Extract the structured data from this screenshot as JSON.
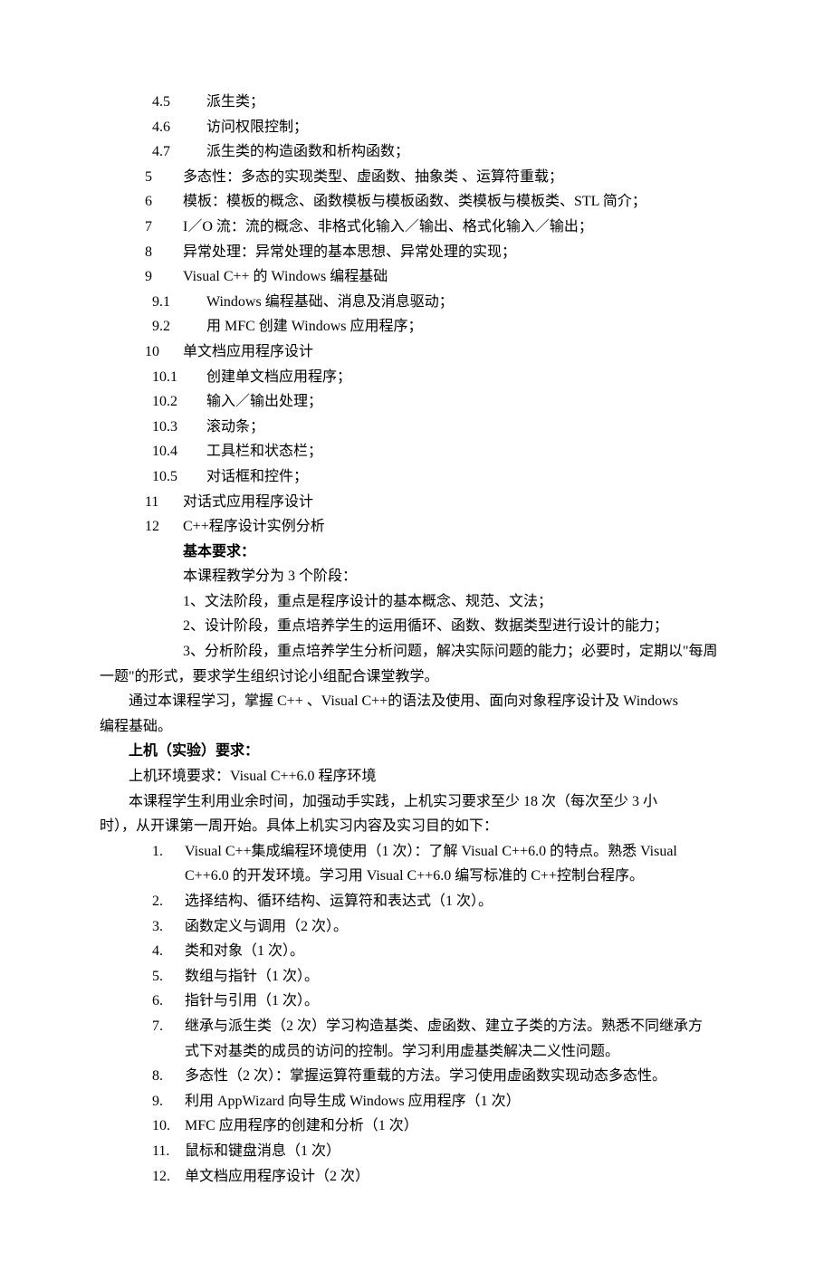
{
  "outline": {
    "sub4": [
      {
        "n": "4.5",
        "t": "派生类；"
      },
      {
        "n": "4.6",
        "t": "访问权限控制；"
      },
      {
        "n": "4.7",
        "t": "派生类的构造函数和析构函数；"
      }
    ],
    "top": [
      {
        "n": "5",
        "t": "多态性：多态的实现类型、虚函数、抽象类 、运算符重载；"
      },
      {
        "n": "6",
        "t": "模板：模板的概念、函数模板与模板函数、类模板与模板类、STL 简介；"
      },
      {
        "n": "7",
        "t": "I／O 流：流的概念、非格式化输入／输出、格式化输入／输出；"
      },
      {
        "n": "8",
        "t": "异常处理：异常处理的基本思想、异常处理的实现；"
      },
      {
        "n": "9",
        "t": "Visual C++  的 Windows 编程基础"
      }
    ],
    "sub9": [
      {
        "n": "9.1",
        "t": "Windows 编程基础、消息及消息驱动；"
      },
      {
        "n": "9.2",
        "t": "用 MFC 创建 Windows 应用程序；"
      }
    ],
    "item10": {
      "n": "10",
      "t": "单文档应用程序设计"
    },
    "sub10": [
      {
        "n": "10.1",
        "t": "创建单文档应用程序；"
      },
      {
        "n": "10.2",
        "t": "输入／输出处理；"
      },
      {
        "n": "10.3",
        "t": "滚动条；"
      },
      {
        "n": "10.4",
        "t": "工具栏和状态栏；"
      },
      {
        "n": "10.5",
        "t": "对话框和控件；"
      }
    ],
    "item11": {
      "n": "11",
      "t": "对话式应用程序设计"
    },
    "item12": {
      "n": "12",
      "t": "C++程序设计实例分析"
    }
  },
  "req": {
    "heading": "基本要求：",
    "p1": "本课程教学分为 3 个阶段：",
    "p2": "1、文法阶段，重点是程序设计的基本概念、规范、文法；",
    "p3": "2、设计阶段，重点培养学生的运用循环、函数、数据类型进行设计的能力；",
    "p4a": "3、分析阶段，重点培养学生分析问题，解决实际问题的能力；必要时，定期以\"每周",
    "p4b": "一题\"的形式，要求学生组织讨论小组配合课堂教学。",
    "p5a": "通过本课程学习，掌握 C++ 、Visual C++的语法及使用、面向对象程序设计及 Windows",
    "p5b": "编程基础。"
  },
  "lab": {
    "heading": "上机（实验）要求：",
    "env": "上机环境要求：Visual C++6.0 程序环境",
    "intro1": "本课程学生利用业余时间，加强动手实践，上机实习要求至少 18 次（每次至少 3 小",
    "intro2": "时），从开课第一周开始。具体上机实习内容及实习目的如下：",
    "items": [
      {
        "n": "1.",
        "t": "Visual C++集成编程环境使用（1 次）：了解 Visual C++6.0 的特点。熟悉 Visual",
        "cont": "C++6.0 的开发环境。学习用 Visual C++6.0 编写标准的 C++控制台程序。"
      },
      {
        "n": "2.",
        "t": "选择结构、循环结构、运算符和表达式（1 次）。"
      },
      {
        "n": "3.",
        "t": "函数定义与调用（2 次）。"
      },
      {
        "n": "4.",
        "t": "类和对象（1 次）。"
      },
      {
        "n": "5.",
        "t": "数组与指针（1 次）。"
      },
      {
        "n": "6.",
        "t": "指针与引用（1 次）。"
      },
      {
        "n": "7.",
        "t": "继承与派生类（2 次）学习构造基类、虚函数、建立子类的方法。熟悉不同继承方",
        "cont": "式下对基类的成员的访问的控制。学习利用虚基类解决二义性问题。"
      },
      {
        "n": "8.",
        "t": "多态性（2 次）：掌握运算符重载的方法。学习使用虚函数实现动态多态性。"
      },
      {
        "n": "9.",
        "t": "利用 AppWizard 向导生成 Windows 应用程序（1 次）"
      },
      {
        "n": "10.",
        "t": "MFC 应用程序的创建和分析（1 次）"
      },
      {
        "n": "11.",
        "t": "鼠标和键盘消息（1 次）"
      },
      {
        "n": "12.",
        "t": "单文档应用程序设计（2 次）"
      }
    ]
  }
}
